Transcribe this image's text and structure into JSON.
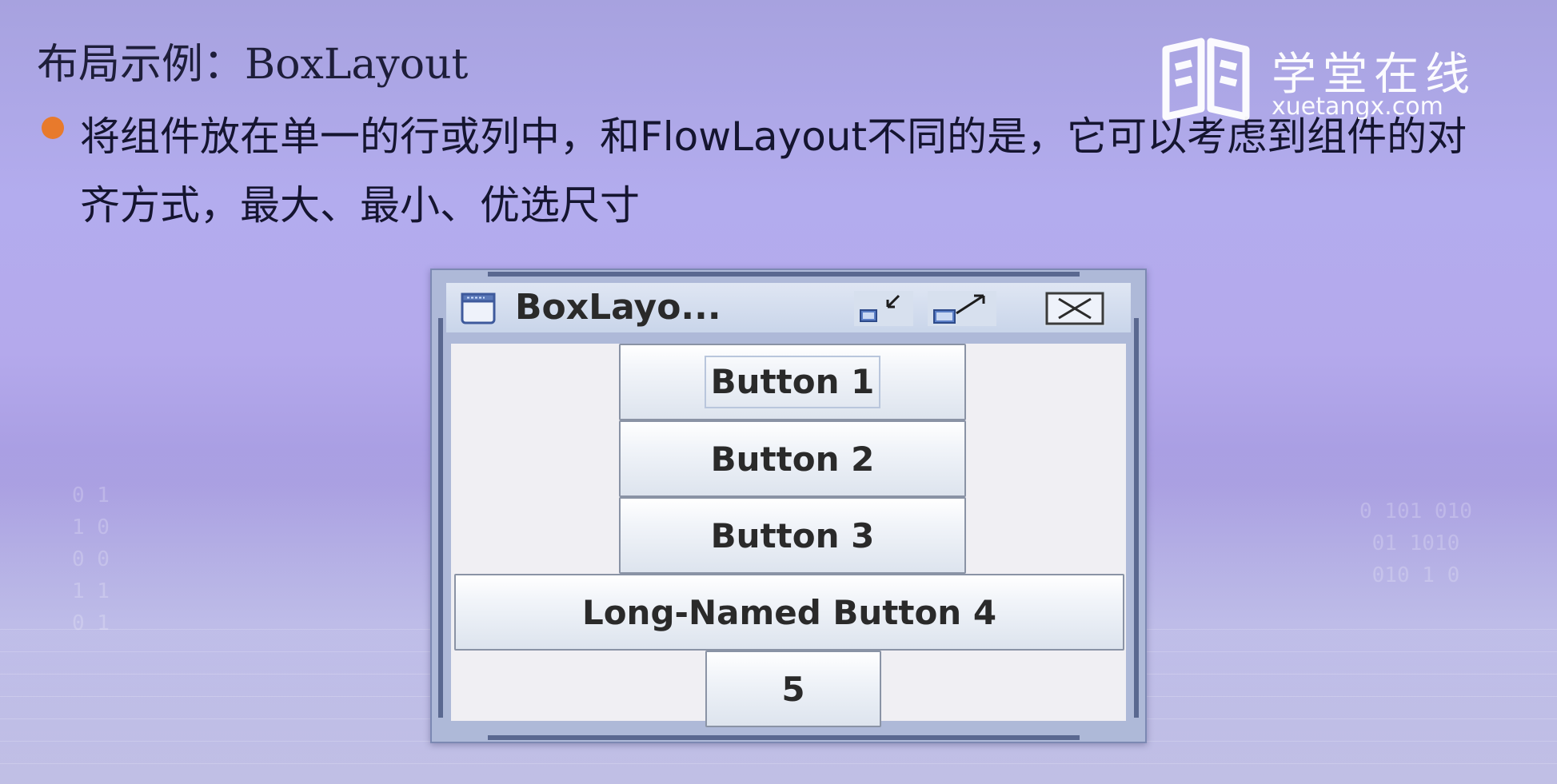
{
  "slide": {
    "title": "布局示例：BoxLayout",
    "bullet_text": "将组件放在单一的行或列中，和FlowLayout不同的是，它可以考虑到组件的对齐方式，最大、最小、优选尺寸"
  },
  "logo": {
    "name_cn": "学堂在线",
    "name_en": "xuetangx.com"
  },
  "window": {
    "title": "BoxLayo...",
    "title_buttons": [
      "iconify",
      "maximize",
      "close"
    ],
    "buttons": [
      {
        "label": "Button 1",
        "focused": true
      },
      {
        "label": "Button 2",
        "focused": false
      },
      {
        "label": "Button 3",
        "focused": false
      },
      {
        "label": "Long-Named Button 4",
        "focused": false
      },
      {
        "label": "5",
        "focused": false
      }
    ]
  },
  "colors": {
    "bullet": "#e87a2c",
    "titlebar": "#c9d5ea",
    "content_bg": "#f0eff3",
    "frame": "#5a6890"
  }
}
